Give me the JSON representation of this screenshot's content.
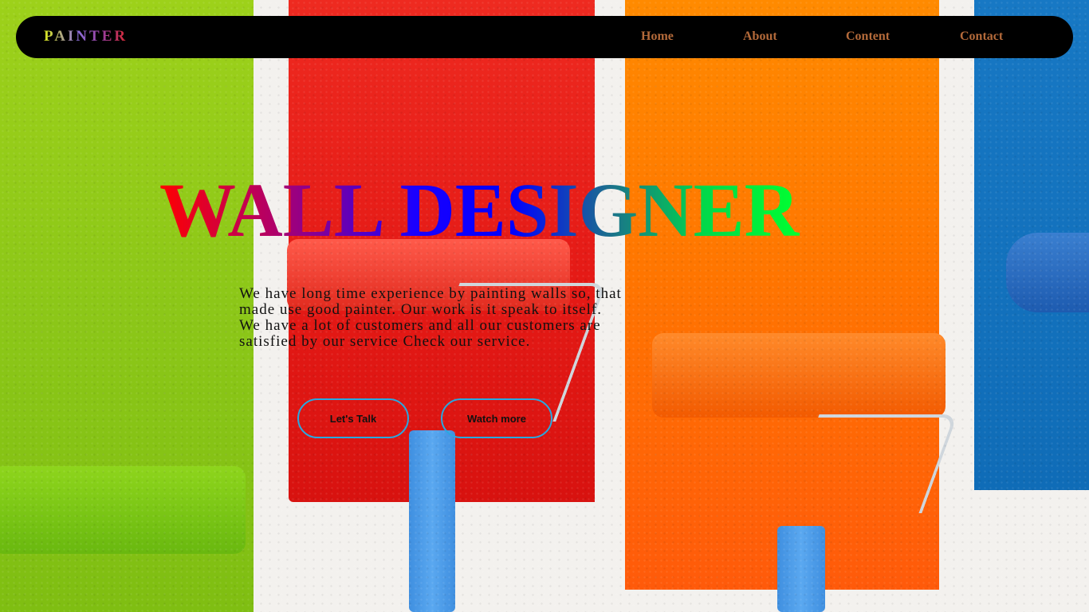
{
  "nav": {
    "logo": "PAINTER",
    "links": [
      "Home",
      "About",
      "Content",
      "Contact"
    ]
  },
  "hero": {
    "title": "WALL DESIGNER",
    "description": "We have long time experience by painting walls so, that made use good painter. Our work is it speak to itself. We have a lot of customers and all our customers are satisfied by our service Check our service.",
    "buttons": [
      "Let's Talk",
      "Watch more"
    ]
  },
  "colors": {
    "navbar": "#000000",
    "nav_link": "#b46a3a",
    "button_border": "#29a8e0",
    "stripe_green": "#8cc718",
    "stripe_red": "#e51a16",
    "stripe_orange": "#ff7600",
    "stripe_blue": "#0f6cb7"
  }
}
